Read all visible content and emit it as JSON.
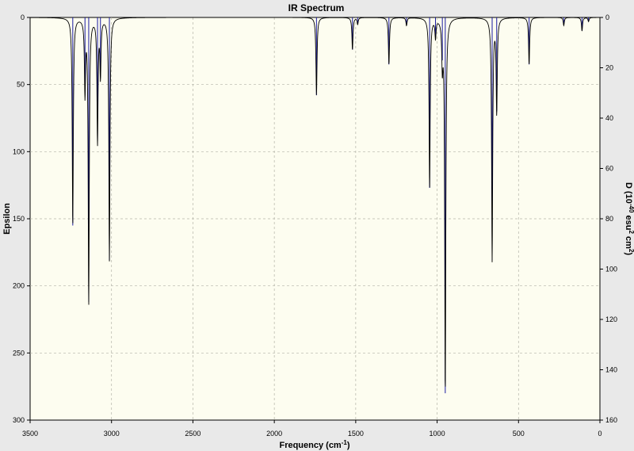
{
  "chart_data": {
    "type": "line",
    "title": "IR Spectrum",
    "xlabel": "Frequency (cm",
    "xlabel_sup": "-1",
    "xlabel_end": ")",
    "ylabel": "Epsilon",
    "ylabel2": {
      "parts": [
        "D (10",
        "-40",
        " esu",
        "2",
        " cm",
        "2",
        ")"
      ]
    },
    "xlim": [
      3500,
      0
    ],
    "ylim": [
      0,
      300
    ],
    "ylim2": [
      0,
      160
    ],
    "x_ticks": [
      3500,
      3000,
      2500,
      2000,
      1500,
      1000,
      500,
      0
    ],
    "y_ticks": [
      0,
      50,
      100,
      150,
      200,
      250,
      300
    ],
    "y2_ticks": [
      0,
      20,
      40,
      60,
      80,
      100,
      120,
      140,
      160
    ],
    "grid": true,
    "colors": {
      "plot_background": "#fdfdf0",
      "frame_background": "#e9e9e9",
      "spectrum_line": "#000000",
      "stick_lines": "#1a1aa0",
      "grid": "#b4b4a8"
    },
    "spectrum_peaks": [
      {
        "x": 3238,
        "epsilon": 155
      },
      {
        "x": 3163,
        "epsilon": 55
      },
      {
        "x": 3140,
        "epsilon": 212
      },
      {
        "x": 3086,
        "epsilon": 92
      },
      {
        "x": 3068,
        "epsilon": 42
      },
      {
        "x": 3013,
        "epsilon": 181
      },
      {
        "x": 1741,
        "epsilon": 58
      },
      {
        "x": 1520,
        "epsilon": 24
      },
      {
        "x": 1488,
        "epsilon": 5
      },
      {
        "x": 1296,
        "epsilon": 35
      },
      {
        "x": 1188,
        "epsilon": 6
      },
      {
        "x": 1046,
        "epsilon": 127
      },
      {
        "x": 1010,
        "epsilon": 14
      },
      {
        "x": 968,
        "epsilon": 32
      },
      {
        "x": 950,
        "epsilon": 280
      },
      {
        "x": 662,
        "epsilon": 181
      },
      {
        "x": 634,
        "epsilon": 70
      },
      {
        "x": 435,
        "epsilon": 35
      },
      {
        "x": 222,
        "epsilon": 6
      },
      {
        "x": 110,
        "epsilon": 10
      },
      {
        "x": 70,
        "epsilon": 3
      }
    ]
  }
}
